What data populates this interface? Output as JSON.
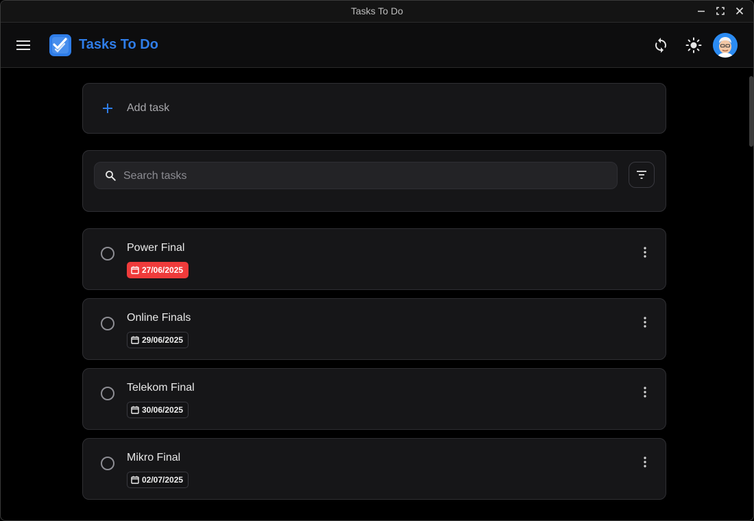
{
  "window": {
    "title": "Tasks To Do"
  },
  "appbar": {
    "brand": "Tasks To Do",
    "accent_color": "#2f7de8",
    "icons": [
      "menu-icon",
      "app-logo-icon",
      "sync-icon",
      "theme-toggle-icon",
      "avatar"
    ]
  },
  "add_task": {
    "label": "Add task"
  },
  "search": {
    "placeholder": "Search tasks",
    "value": ""
  },
  "tasks": [
    {
      "title": "Power Final",
      "date": "27/06/2025",
      "overdue": true
    },
    {
      "title": "Online Finals",
      "date": "29/06/2025",
      "overdue": false
    },
    {
      "title": "Telekom Final",
      "date": "30/06/2025",
      "overdue": false
    },
    {
      "title": "Mikro Final",
      "date": "02/07/2025",
      "overdue": false
    }
  ],
  "colors": {
    "overdue_badge": "#ef3b3b",
    "background": "#000000",
    "card": "#161618"
  }
}
